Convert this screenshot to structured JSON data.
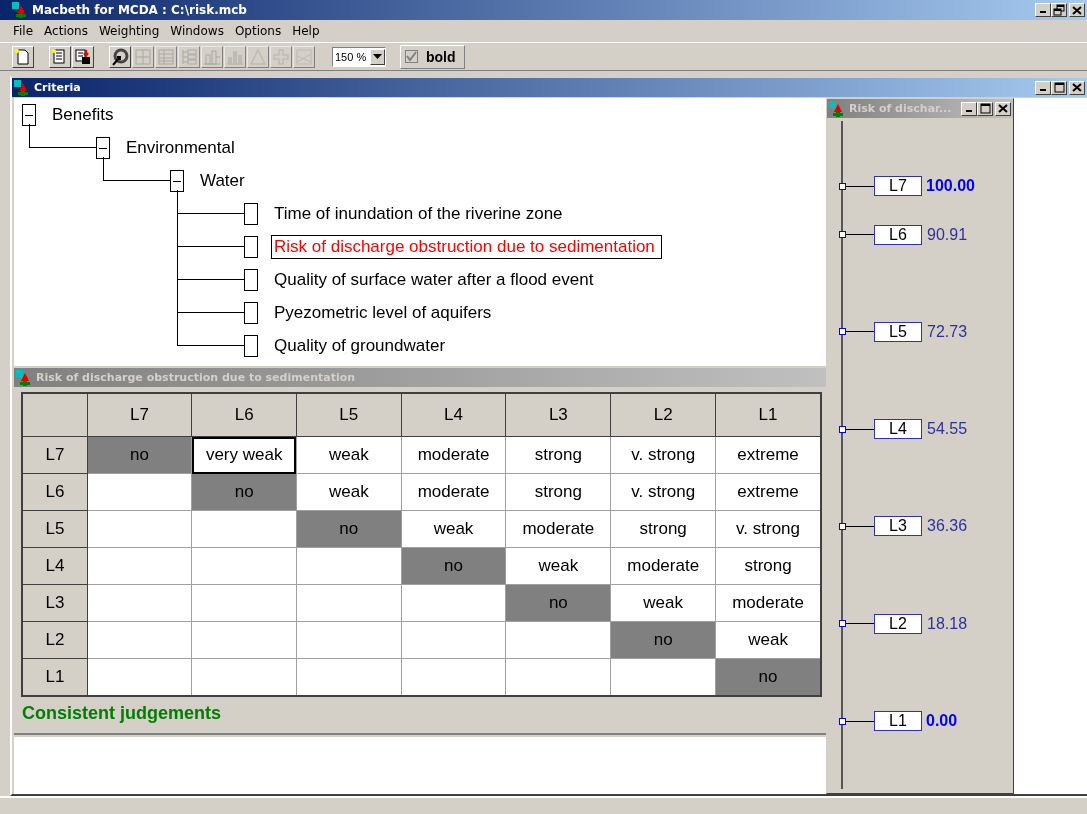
{
  "window": {
    "title": "Macbeth for MCDA : C:\\risk.mcb"
  },
  "menu": [
    {
      "label": "File"
    },
    {
      "label": "Actions"
    },
    {
      "label": "Weighting"
    },
    {
      "label": "Windows"
    },
    {
      "label": "Options"
    },
    {
      "label": "Help"
    }
  ],
  "toolbar": {
    "buttons": [
      {
        "kind": "new",
        "disabled": false
      },
      {
        "kind": "open",
        "disabled": false
      },
      {
        "kind": "save",
        "disabled": false
      },
      {
        "kind": "pointer",
        "disabled": false
      },
      {
        "kind": "grid",
        "disabled": true
      },
      {
        "kind": "table",
        "disabled": true
      },
      {
        "kind": "tree",
        "disabled": true
      },
      {
        "kind": "bars",
        "disabled": true
      },
      {
        "kind": "histogram",
        "disabled": true
      },
      {
        "kind": "triangle",
        "disabled": true
      },
      {
        "kind": "cross",
        "disabled": true
      },
      {
        "kind": "scatter",
        "disabled": true
      }
    ],
    "zoom": {
      "value": "150 %"
    },
    "bold_option": {
      "label": "bold",
      "checked": true
    }
  },
  "criteria_window": {
    "title": "Criteria",
    "active": true,
    "tree": [
      {
        "label": "Benefits",
        "expanded": true,
        "selected": false,
        "children": [
          {
            "label": "Environmental",
            "expanded": true,
            "selected": false,
            "children": [
              {
                "label": "Water",
                "expanded": true,
                "selected": false,
                "children": [
                  {
                    "label": "Time of inundation of the riverine zone",
                    "selected": false
                  },
                  {
                    "label": "Risk of discharge obstruction due to sedimentation",
                    "selected": true
                  },
                  {
                    "label": "Quality of surface water after a flood event",
                    "selected": false
                  },
                  {
                    "label": "Pyezometric level of aquifers",
                    "selected": false
                  },
                  {
                    "label": "Quality of groundwater",
                    "selected": false
                  }
                ]
              }
            ]
          }
        ]
      }
    ]
  },
  "matrix_window": {
    "title": "Risk of discharge obstruction due to sedimentation",
    "active": false,
    "columns": [
      "L7",
      "L6",
      "L5",
      "L4",
      "L3",
      "L2",
      "L1"
    ],
    "rows": [
      {
        "label": "L7",
        "cells": [
          {
            "kind": "diagonal",
            "text": "no",
            "selected": false
          },
          {
            "kind": "judgement",
            "text": "very weak",
            "selected": true
          },
          {
            "kind": "judgement",
            "text": "weak",
            "selected": false
          },
          {
            "kind": "judgement",
            "text": "moderate",
            "selected": false
          },
          {
            "kind": "judgement",
            "text": "strong",
            "selected": false
          },
          {
            "kind": "judgement",
            "text": "v. strong",
            "selected": false
          },
          {
            "kind": "judgement",
            "text": "extreme",
            "selected": false
          }
        ]
      },
      {
        "label": "L6",
        "cells": [
          {
            "kind": "blank",
            "selected": false
          },
          {
            "kind": "diagonal",
            "text": "no",
            "selected": false
          },
          {
            "kind": "judgement",
            "text": "weak",
            "selected": false
          },
          {
            "kind": "judgement",
            "text": "moderate",
            "selected": false
          },
          {
            "kind": "judgement",
            "text": "strong",
            "selected": false
          },
          {
            "kind": "judgement",
            "text": "v. strong",
            "selected": false
          },
          {
            "kind": "judgement",
            "text": "extreme",
            "selected": false
          }
        ]
      },
      {
        "label": "L5",
        "cells": [
          {
            "kind": "blank",
            "selected": false
          },
          {
            "kind": "blank",
            "selected": false
          },
          {
            "kind": "diagonal",
            "text": "no",
            "selected": false
          },
          {
            "kind": "judgement",
            "text": "weak",
            "selected": false
          },
          {
            "kind": "judgement",
            "text": "moderate",
            "selected": false
          },
          {
            "kind": "judgement",
            "text": "strong",
            "selected": false
          },
          {
            "kind": "judgement",
            "text": "v. strong",
            "selected": false
          }
        ]
      },
      {
        "label": "L4",
        "cells": [
          {
            "kind": "blank",
            "selected": false
          },
          {
            "kind": "blank",
            "selected": false
          },
          {
            "kind": "blank",
            "selected": false
          },
          {
            "kind": "diagonal",
            "text": "no",
            "selected": false
          },
          {
            "kind": "judgement",
            "text": "weak",
            "selected": false
          },
          {
            "kind": "judgement",
            "text": "moderate",
            "selected": false
          },
          {
            "kind": "judgement",
            "text": "strong",
            "selected": false
          }
        ]
      },
      {
        "label": "L3",
        "cells": [
          {
            "kind": "blank",
            "selected": false
          },
          {
            "kind": "blank",
            "selected": false
          },
          {
            "kind": "blank",
            "selected": false
          },
          {
            "kind": "blank",
            "selected": false
          },
          {
            "kind": "diagonal",
            "text": "no",
            "selected": false
          },
          {
            "kind": "judgement",
            "text": "weak",
            "selected": false
          },
          {
            "kind": "judgement",
            "text": "moderate",
            "selected": false
          }
        ]
      },
      {
        "label": "L2",
        "cells": [
          {
            "kind": "blank",
            "selected": false
          },
          {
            "kind": "blank",
            "selected": false
          },
          {
            "kind": "blank",
            "selected": false
          },
          {
            "kind": "blank",
            "selected": false
          },
          {
            "kind": "blank",
            "selected": false
          },
          {
            "kind": "diagonal",
            "text": "no",
            "selected": false
          },
          {
            "kind": "judgement",
            "text": "weak",
            "selected": false
          }
        ]
      },
      {
        "label": "L1",
        "cells": [
          {
            "kind": "blank",
            "selected": false
          },
          {
            "kind": "blank",
            "selected": false
          },
          {
            "kind": "blank",
            "selected": false
          },
          {
            "kind": "blank",
            "selected": false
          },
          {
            "kind": "blank",
            "selected": false
          },
          {
            "kind": "blank",
            "selected": false
          },
          {
            "kind": "diagonal",
            "text": "no",
            "selected": false
          }
        ]
      }
    ],
    "status": "Consistent judgements"
  },
  "scale_window": {
    "title": "Risk of dischar...",
    "active": false,
    "levels": [
      {
        "label": "L7",
        "value": "100.00",
        "fixed": true
      },
      {
        "label": "L6",
        "value": "90.91",
        "fixed": false
      },
      {
        "label": "L5",
        "value": "72.73",
        "fixed": false
      },
      {
        "label": "L4",
        "value": "54.55",
        "fixed": false
      },
      {
        "label": "L3",
        "value": "36.36",
        "fixed": false
      },
      {
        "label": "L2",
        "value": "18.18",
        "fixed": false
      },
      {
        "label": "L1",
        "value": "0.00",
        "fixed": true
      }
    ]
  }
}
